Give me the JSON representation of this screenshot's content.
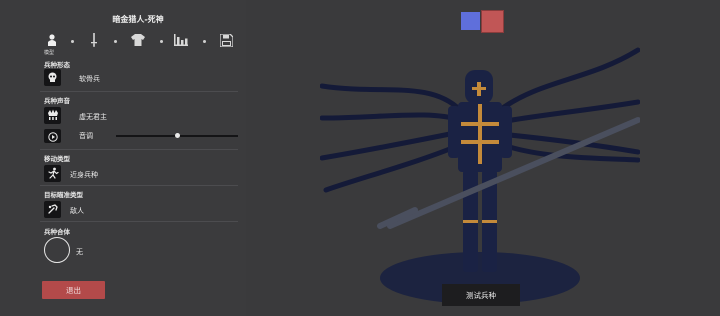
{
  "header": {
    "title": "暗金猎人-死神"
  },
  "tabs": {
    "active_label": "模型",
    "items": [
      {
        "icon": "person-icon"
      },
      {
        "icon": "sword-icon"
      },
      {
        "icon": "shirt-icon"
      },
      {
        "icon": "stats-icon"
      },
      {
        "icon": "save-icon"
      }
    ]
  },
  "sections": {
    "form": {
      "label": "兵种形态",
      "value": "软骨兵",
      "icon": "skull-icon"
    },
    "voice": {
      "label": "兵种声音",
      "value": "虚无君主",
      "icon": "crown-voice-icon",
      "pitch_label": "音调",
      "pitch_value": 0.5
    },
    "movement": {
      "label": "移动类型",
      "value": "近身兵种",
      "icon": "running-icon"
    },
    "target": {
      "label": "目标瞄准类型",
      "value": "敌人",
      "icon": "target-icon"
    },
    "combo": {
      "label": "兵种合体",
      "value": "无"
    }
  },
  "buttons": {
    "exit": "退出",
    "test": "测试兵种"
  },
  "colors": {
    "primary": "#5f6fdb",
    "secondary": "#c15656",
    "exit": "#b34a4a",
    "background": "#3a3a3c"
  }
}
